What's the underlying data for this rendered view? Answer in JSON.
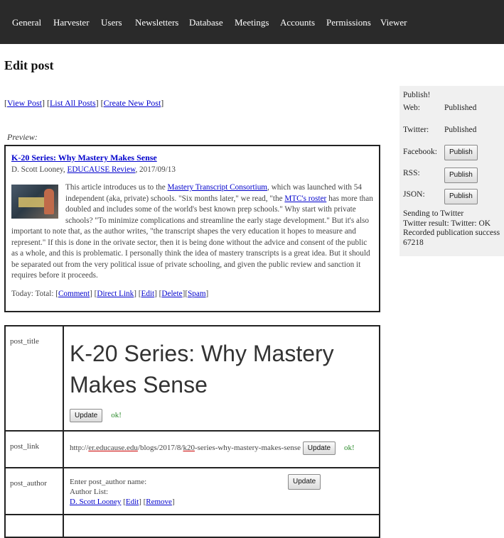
{
  "nav": [
    "General",
    "Harvester",
    "Users",
    "Newsletters",
    "Database",
    "Meetings",
    "Accounts",
    "Permissions",
    "Viewer"
  ],
  "page_title": "Edit post",
  "actions": {
    "view_post": "View Post",
    "list_all": "List All Posts",
    "create_new": "Create New Post"
  },
  "preview": {
    "label": "Preview:",
    "title": "K-20 Series: Why Mastery Makes Sense",
    "author": "D. Scott Looney",
    "source": "EDUCAUSE Review",
    "date": "2017/09/13",
    "body_1": "This article introduces us to the ",
    "link_1": "Mastery Transcript Consortium",
    "body_2": ", which was launched with 54 independent (aka, private) schools. \"Six months later,\" we read, \"the ",
    "link_2": "MTC's roster",
    "body_3": " has more than doubled and includes some of the world's best known prep schools.\" Why start with private schools? \"To minimize complications and streamline the early stage development.\" But it's also important to note that, as the author writes, \"the transcript shapes the very education it hopes to measure and represent.\" If this is done in the orivate sector, then it is being done without the advice and consent of the public as a whole, and this is problematic. I personally think the idea of mastery transcripts is a great idea. But it should be separated out from the very political issue of private schooling, and given the public review and sanction it requires before it proceeds.",
    "today_label": "Today: Total:",
    "links": {
      "comment": "Comment",
      "direct_link": "Direct Link",
      "edit": "Edit",
      "delete": "Delete",
      "spam": "Spam"
    }
  },
  "publish": {
    "header": "Publish!",
    "rows": [
      {
        "label": "Web:",
        "value": "Published"
      },
      {
        "label": "Twitter:",
        "value": "Published"
      },
      {
        "label": "Facebook:",
        "button": "Publish"
      },
      {
        "label": "RSS:",
        "button": "Publish"
      },
      {
        "label": "JSON:",
        "button": "Publish"
      }
    ],
    "status": [
      "Sending to Twitter",
      "Twitter result: Twitter: OK",
      "Recorded publication success",
      "67218"
    ]
  },
  "fields": {
    "post_title": {
      "key": "post_title",
      "value": "K-20 Series: Why Mastery Makes Sense",
      "button": "Update",
      "ok": "ok!"
    },
    "post_link": {
      "key": "post_link",
      "prefix": "http://",
      "host": "er.educause.edu",
      "path_a": "/blogs/2017/8/",
      "path_b": "k20",
      "path_c": "-series-why-mastery-makes-sense",
      "button": "Update",
      "ok": "ok!"
    },
    "post_author": {
      "key": "post_author",
      "prompt": "Enter post_author name:",
      "button": "Update",
      "list_label": "Author List:",
      "author": "D. Scott Looney",
      "edit": "Edit",
      "remove": "Remove"
    }
  }
}
